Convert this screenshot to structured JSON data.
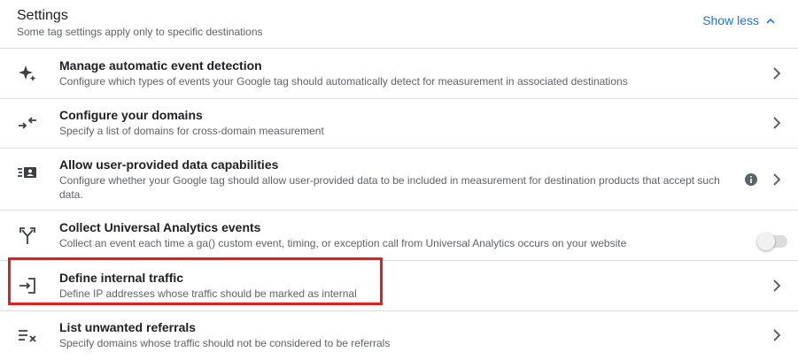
{
  "header": {
    "title": "Settings",
    "subtitle": "Some tag settings apply only to specific destinations",
    "toggle_label": "Show less"
  },
  "rows": [
    {
      "label": "Manage automatic event detection",
      "desc": "Configure which types of events your Google tag should automatically detect for measurement in associated destinations",
      "icon": "sparkle-icon"
    },
    {
      "label": "Configure your domains",
      "desc": "Specify a list of domains for cross-domain measurement",
      "icon": "merge-arrows-icon"
    },
    {
      "label": "Allow user-provided data capabilities",
      "desc": "Configure whether your Google tag should allow user-provided data to be included in measurement for destination products that accept such data.",
      "icon": "contact-list-icon"
    },
    {
      "label": "Collect Universal Analytics events",
      "desc": "Collect an event each time a ga() custom event, timing, or exception call from Universal Analytics occurs on your website",
      "icon": "fork-arrow-icon",
      "toggle_on": false
    },
    {
      "label": "Define internal traffic",
      "desc": "Define IP addresses whose traffic should be marked as internal",
      "icon": "login-arrow-icon"
    },
    {
      "label": "List unwanted referrals",
      "desc": "Specify domains whose traffic should not be considered to be referrals",
      "icon": "list-remove-icon"
    }
  ],
  "colors": {
    "accent": "#1a73e8",
    "highlight": "#e02020"
  }
}
